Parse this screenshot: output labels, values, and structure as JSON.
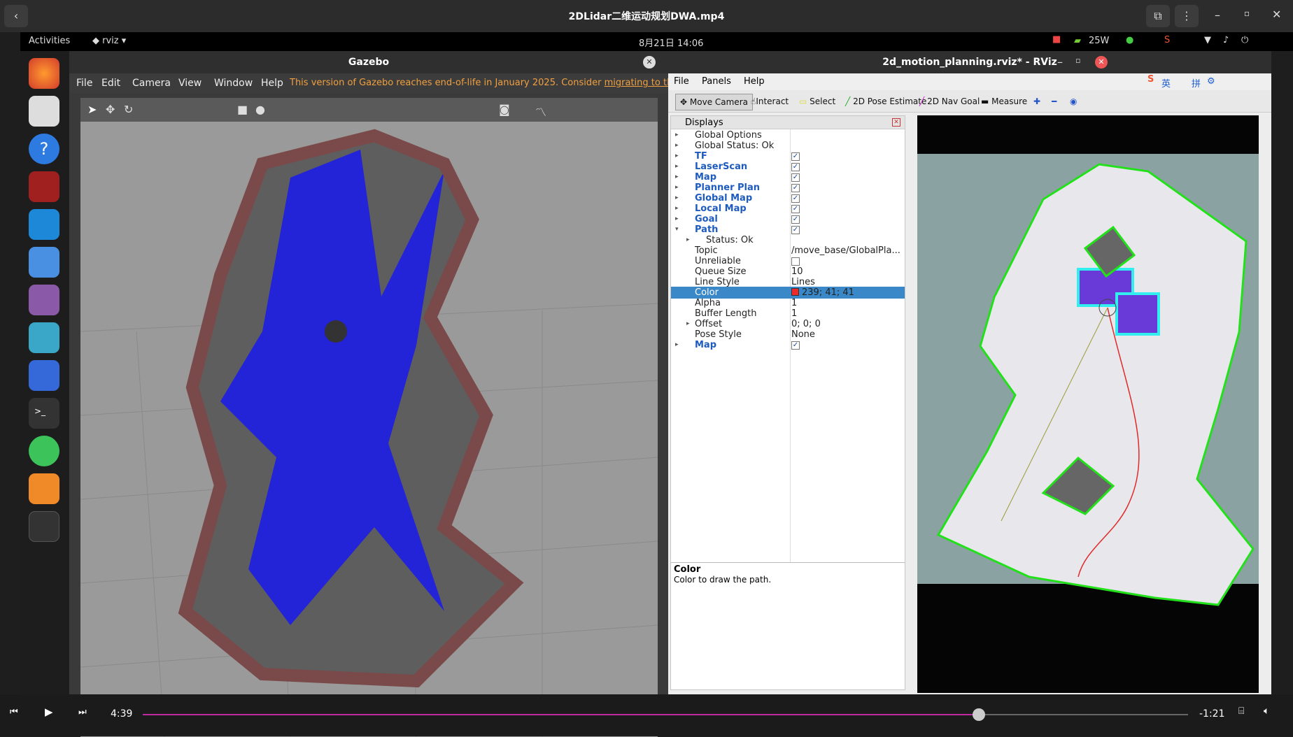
{
  "player": {
    "title": "2DLidar二维运动规划DWA.mp4",
    "current_time": "4:39",
    "remaining_time": "-1:21",
    "progress": 0.8
  },
  "topbar": {
    "activities": "Activities",
    "app": "rviz",
    "datetime": "8月21日 14:06",
    "power": "25W"
  },
  "gazebo": {
    "title": "Gazebo",
    "menu": [
      "File",
      "Edit",
      "Camera",
      "View",
      "Window",
      "Help"
    ],
    "notice": "This version of Gazebo reaches end-of-life in January 2025. Consider",
    "notice_link": "migrating to the n"
  },
  "rviz": {
    "title": "2d_motion_planning.rviz* - RViz",
    "menu": [
      "File",
      "Panels",
      "Help"
    ],
    "tools": [
      "Move Camera",
      "Interact",
      "Select",
      "2D Pose Estimate",
      "2D Nav Goal",
      "Measure"
    ],
    "ime": [
      "英",
      "拼"
    ],
    "displays_title": "Displays",
    "items": [
      {
        "label": "Global Options",
        "blue": false,
        "check": false
      },
      {
        "label": "Global Status: Ok",
        "blue": false,
        "check": false
      },
      {
        "label": "TF",
        "blue": true,
        "check": true
      },
      {
        "label": "LaserScan",
        "blue": true,
        "check": true
      },
      {
        "label": "Map",
        "blue": true,
        "check": true
      },
      {
        "label": "Planner Plan",
        "blue": true,
        "check": true
      },
      {
        "label": "Global Map",
        "blue": true,
        "check": true
      },
      {
        "label": "Local Map",
        "blue": true,
        "check": true
      },
      {
        "label": "Goal",
        "blue": true,
        "check": true
      },
      {
        "label": "Path",
        "blue": true,
        "check": true
      }
    ],
    "path_props": [
      {
        "label": "Status: Ok",
        "value": ""
      },
      {
        "label": "Topic",
        "value": "/move_base/GlobalPla..."
      },
      {
        "label": "Unreliable",
        "value": ""
      },
      {
        "label": "Queue Size",
        "value": "10"
      },
      {
        "label": "Line Style",
        "value": "Lines"
      },
      {
        "label": "Color",
        "value": "239; 41; 41"
      },
      {
        "label": "Alpha",
        "value": "1"
      },
      {
        "label": "Buffer Length",
        "value": "1"
      },
      {
        "label": "Offset",
        "value": "0; 0; 0"
      },
      {
        "label": "Pose Style",
        "value": "None"
      }
    ],
    "last_item": "Map",
    "help_title": "Color",
    "help_text": "Color to draw the path."
  }
}
